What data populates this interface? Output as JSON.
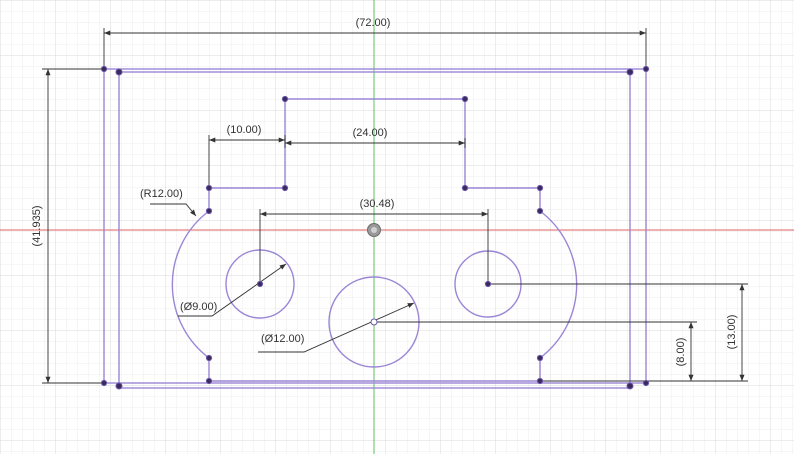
{
  "colors": {
    "background": "#ffffff",
    "grid_minor": "#ececec",
    "grid_major": "#d8d8d8",
    "axis_x": "#e06060",
    "axis_y": "#60c060",
    "sketch": "#9b86d6",
    "dimension": "#333333"
  },
  "dimensions": {
    "overall_width": "(72.00)",
    "overall_height": "(41.935)",
    "slot_offset": "(10.00)",
    "slot_width": "(24.00)",
    "hole_spacing": "(30.48)",
    "arc_radius": "(R12.00)",
    "small_hole_dia": "(Ø9.00)",
    "center_hole_dia": "(Ø12.00)",
    "center_hole_height": "(8.00)",
    "side_hole_height": "(13.00)"
  },
  "icons": {
    "origin": "origin-icon"
  }
}
